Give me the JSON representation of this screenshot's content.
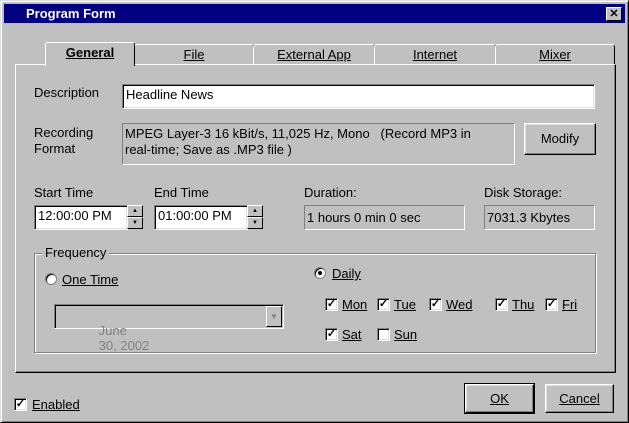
{
  "window": {
    "title": "Program Form",
    "close_glyph": "✕"
  },
  "tabs": [
    {
      "label": "General",
      "active": true
    },
    {
      "label": "File",
      "active": false
    },
    {
      "label": "External App",
      "active": false
    },
    {
      "label": "Internet",
      "active": false
    },
    {
      "label": "Mixer",
      "active": false
    }
  ],
  "general": {
    "description_label": "Description",
    "description_value": "Headline News",
    "recording_label_1": "Recording",
    "recording_label_2": "Format",
    "recording_format_line1": "MPEG Layer-3 16 kBit/s, 11,025 Hz, Mono   (Record MP3 in",
    "recording_format_line2": "real-time; Save as .MP3 file )",
    "modify_label": "Modify",
    "start_time_label": "Start Time",
    "start_time_value": "12:00:00 PM",
    "end_time_label": "End Time",
    "end_time_value": "01:00:00 PM",
    "duration_label": "Duration:",
    "duration_value": "1 hours 0 min 0 sec",
    "disk_storage_label": "Disk Storage:",
    "disk_storage_value": "7031.3 Kbytes"
  },
  "frequency": {
    "group_label": "Frequency",
    "one_time_label": "One Time",
    "one_time_selected": false,
    "date_month": "June",
    "date_day_year": "30, 2002",
    "daily_label": "Daily",
    "daily_selected": true,
    "days": [
      {
        "label": "Mon",
        "checked": true
      },
      {
        "label": "Tue",
        "checked": true
      },
      {
        "label": "Wed",
        "checked": true
      },
      {
        "label": "Thu",
        "checked": true
      },
      {
        "label": "Fri",
        "checked": true
      },
      {
        "label": "Sat",
        "checked": true
      },
      {
        "label": "Sun",
        "checked": false
      }
    ]
  },
  "footer": {
    "enabled_label": "Enabled",
    "enabled_checked": true,
    "ok_label": "OK",
    "cancel_label": "Cancel"
  }
}
